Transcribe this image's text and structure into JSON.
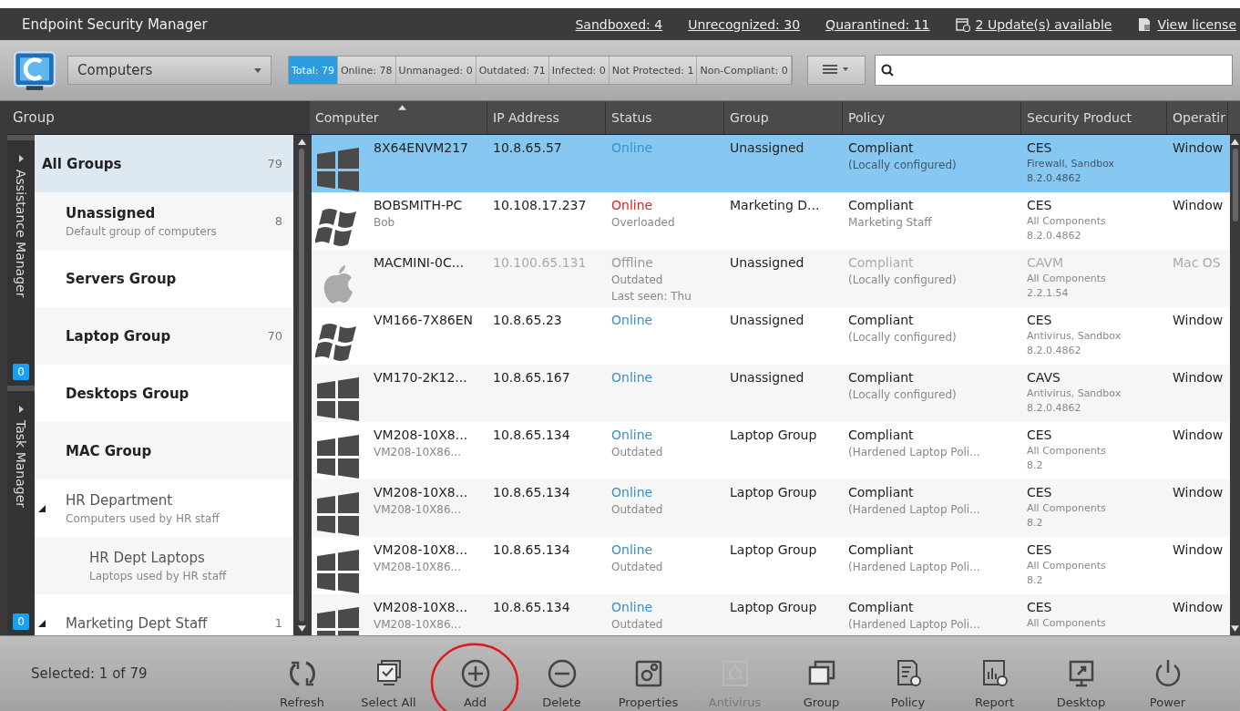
{
  "window": {
    "title": "Endpoint Security Manager"
  },
  "header_links": [
    {
      "label": "Sandboxed: 4",
      "kind": "plain"
    },
    {
      "label": "Unrecognized: 30",
      "kind": "plain"
    },
    {
      "label": "Quarantined: 11",
      "kind": "plain"
    },
    {
      "label": "2 Update(s) available",
      "kind": "update"
    },
    {
      "label": "View license",
      "kind": "license"
    }
  ],
  "toolbar": {
    "view_select": "Computers",
    "filters": [
      {
        "label": "Total: 79",
        "selected": true
      },
      {
        "label": "Online: 78",
        "selected": false
      },
      {
        "label": "Unmanaged: 0",
        "selected": false
      },
      {
        "label": "Outdated: 71",
        "selected": false
      },
      {
        "label": "Infected: 0",
        "selected": false
      },
      {
        "label": "Not Protected: 1",
        "selected": false
      },
      {
        "label": "Non-Compliant: 0",
        "selected": false
      }
    ]
  },
  "side_tabs": [
    {
      "label": "Assistance Manager",
      "badge": "0"
    },
    {
      "label": "Task Manager",
      "badge": "0"
    }
  ],
  "group_panel": {
    "title": "Group",
    "items": [
      {
        "name": "All Groups",
        "count": "79",
        "kind": "builtin",
        "selected": true
      },
      {
        "name": "Unassigned",
        "description": "Default group of computers",
        "count": "8",
        "kind": "builtin",
        "selected": false
      },
      {
        "name": "Servers Group",
        "kind": "builtin",
        "selected": false
      },
      {
        "name": "Laptop Group",
        "count": "70",
        "kind": "builtin",
        "selected": false
      },
      {
        "name": "Desktops Group",
        "kind": "builtin",
        "selected": false
      },
      {
        "name": "MAC Group",
        "kind": "builtin",
        "selected": false
      },
      {
        "name": "HR Department",
        "description": "Computers used by HR staff",
        "kind": "custom",
        "selected": false,
        "expanded": true,
        "children": [
          {
            "name": "HR Dept Laptops",
            "description": "Laptops used by HR staff",
            "selected": false
          }
        ]
      },
      {
        "name": "Marketing Dept Staff",
        "count": "1",
        "kind": "custom",
        "selected": false,
        "expanded": true
      }
    ]
  },
  "table": {
    "columns": [
      {
        "label": "Computer",
        "sorted": true
      },
      {
        "label": "IP Address",
        "sorted": false
      },
      {
        "label": "Status",
        "sorted": false
      },
      {
        "label": "Group",
        "sorted": false
      },
      {
        "label": "Policy",
        "sorted": false
      },
      {
        "label": "Security Product",
        "sorted": false
      },
      {
        "label": "Operatir",
        "sorted": false
      }
    ],
    "rows": [
      {
        "kind": "win10",
        "name": "8X64ENVM217",
        "ip": "10.8.65.57",
        "offline": false,
        "alert": false,
        "status": "Online",
        "group": "Unassigned",
        "policy": "Compliant",
        "policy_note": "(Locally configured)",
        "product": "CES",
        "product_notes": [
          "Firewall, Sandbox",
          "8.2.0.4862"
        ],
        "os_name": "Window",
        "selected": true
      },
      {
        "kind": "win7",
        "name": "BOBSMITH-PC",
        "user": "Bob",
        "ip": "10.108.17.237",
        "offline": false,
        "alert": true,
        "status": "Online",
        "status_notes": [
          "Overloaded"
        ],
        "group": "Marketing D...",
        "policy": "Compliant",
        "policy_note": "Marketing Staff",
        "product": "CES",
        "product_notes": [
          "All Components",
          "8.2.0.4862"
        ],
        "os_name": "Window",
        "selected": false
      },
      {
        "kind": "apple",
        "name": "MACMINI-0C...",
        "ip": "10.100.65.131",
        "offline": true,
        "alert": false,
        "status": "Offline",
        "status_notes": [
          "Outdated",
          "Last seen: Thu"
        ],
        "group": "Unassigned",
        "policy": "Compliant",
        "policy_note": "(Locally configured)",
        "product": "CAVM",
        "product_notes": [
          "All Components",
          "2.2.1.54"
        ],
        "os_name": "Mac OS",
        "selected": false
      },
      {
        "kind": "win7",
        "name": "VM166-7X86EN",
        "ip": "10.8.65.23",
        "offline": false,
        "alert": false,
        "status": "Online",
        "group": "Unassigned",
        "policy": "Compliant",
        "policy_note": "(Locally configured)",
        "product": "CES",
        "product_notes": [
          "Antivirus, Sandbox",
          "8.2.0.4862"
        ],
        "os_name": "Window",
        "selected": false
      },
      {
        "kind": "win10",
        "name": "VM170-2K12...",
        "ip": "10.8.65.167",
        "offline": false,
        "alert": false,
        "status": "Online",
        "group": "Unassigned",
        "policy": "Compliant",
        "policy_note": "(Locally configured)",
        "product": "CAVS",
        "product_notes": [
          "Antivirus, Sandbox",
          "8.2.0.4862"
        ],
        "os_name": "Window",
        "selected": false
      },
      {
        "kind": "win10",
        "name": "VM208-10X8...",
        "user": "VM208-10X86...",
        "ip": "10.8.65.134",
        "offline": false,
        "alert": false,
        "status": "Online",
        "status_notes": [
          "Outdated"
        ],
        "group": "Laptop Group",
        "policy": "Compliant",
        "policy_note": "(Hardened Laptop Poli...",
        "product": "CES",
        "product_notes": [
          "All Components",
          "8.2"
        ],
        "os_name": "Window",
        "selected": false
      },
      {
        "kind": "win10",
        "name": "VM208-10X8...",
        "user": "VM208-10X86...",
        "ip": "10.8.65.134",
        "offline": false,
        "alert": false,
        "status": "Online",
        "status_notes": [
          "Outdated"
        ],
        "group": "Laptop Group",
        "policy": "Compliant",
        "policy_note": "(Hardened Laptop Poli...",
        "product": "CES",
        "product_notes": [
          "All Components",
          "8.2"
        ],
        "os_name": "Window",
        "selected": false
      },
      {
        "kind": "win10",
        "name": "VM208-10X8...",
        "user": "VM208-10X86...",
        "ip": "10.8.65.134",
        "offline": false,
        "alert": false,
        "status": "Online",
        "status_notes": [
          "Outdated"
        ],
        "group": "Laptop Group",
        "policy": "Compliant",
        "policy_note": "(Hardened Laptop Poli...",
        "product": "CES",
        "product_notes": [
          "All Components",
          "8.2"
        ],
        "os_name": "Window",
        "selected": false
      },
      {
        "kind": "win10",
        "name": "VM208-10X8...",
        "user": "VM208-10X86...",
        "ip": "10.8.65.134",
        "offline": false,
        "alert": false,
        "status": "Online",
        "status_notes": [
          "Outdated"
        ],
        "group": "Laptop Group",
        "policy": "Compliant",
        "policy_note": "(Hardened Laptop Poli...",
        "product": "CES",
        "product_notes": [
          "All Components"
        ],
        "os_name": "Window",
        "selected": false
      }
    ]
  },
  "bottom_bar": {
    "selection": "Selected: 1 of 79",
    "actions": [
      {
        "label": "Refresh",
        "kind": "refresh",
        "disabled": false,
        "highlighted": false
      },
      {
        "label": "Select All",
        "kind": "select-all",
        "disabled": false,
        "highlighted": false
      },
      {
        "label": "Add",
        "kind": "add",
        "disabled": false,
        "highlighted": true
      },
      {
        "label": "Delete",
        "kind": "delete",
        "disabled": false,
        "highlighted": false
      },
      {
        "label": "Properties",
        "kind": "properties",
        "disabled": false,
        "highlighted": false
      },
      {
        "label": "Antivirus",
        "kind": "antivirus",
        "disabled": true,
        "highlighted": false
      },
      {
        "label": "Group",
        "kind": "group",
        "disabled": false,
        "highlighted": false
      },
      {
        "label": "Policy",
        "kind": "policy",
        "disabled": false,
        "highlighted": false
      },
      {
        "label": "Report",
        "kind": "report",
        "disabled": false,
        "highlighted": false
      },
      {
        "label": "Desktop",
        "kind": "desktop",
        "disabled": false,
        "highlighted": false
      },
      {
        "label": "Power",
        "kind": "power",
        "disabled": false,
        "highlighted": false
      }
    ]
  }
}
